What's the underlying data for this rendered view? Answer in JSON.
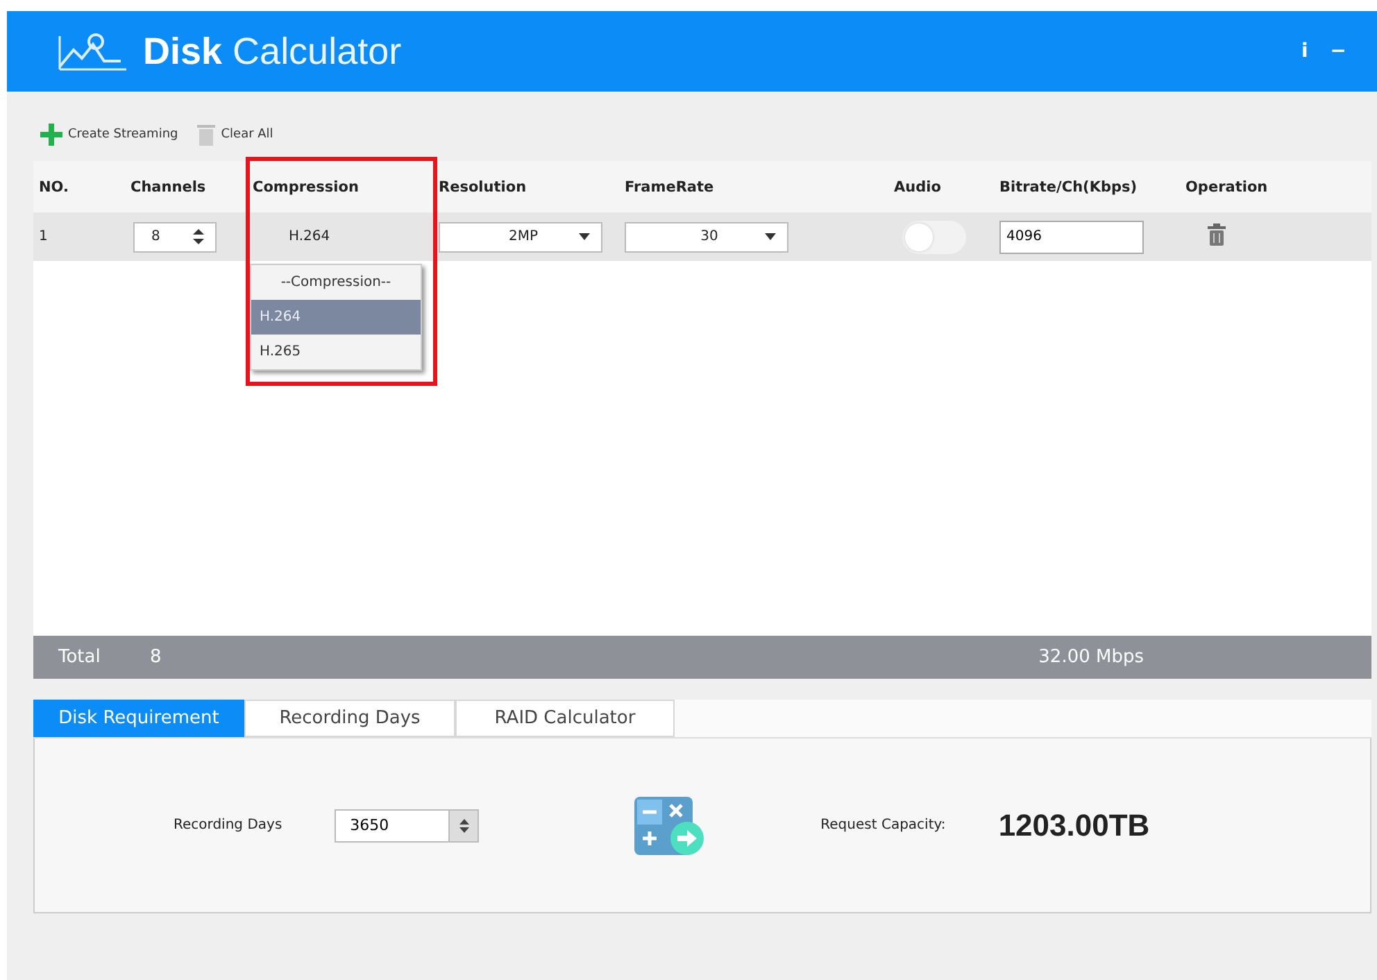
{
  "window": {
    "title_bold": "Disk",
    "title": "Calculator",
    "controls": [
      "i",
      "−"
    ]
  },
  "toolbar": [
    {
      "label": "Create Streaming",
      "kind": "add"
    },
    {
      "label": "Clear All",
      "kind": "clear"
    }
  ],
  "table": {
    "columns": [
      "NO.",
      "Channels",
      "Compression",
      "Resolution",
      "FrameRate",
      "Audio",
      "Bitrate/Ch(Kbps)",
      "Operation"
    ],
    "rows": [
      {
        "no": "1",
        "channels": "8",
        "compression": "H.264",
        "resolution": "2MP",
        "framerate": "30",
        "audio": false,
        "bitrate": "4096"
      }
    ]
  },
  "dropdown": {
    "options": [
      {
        "label": "--Compression--",
        "selected": false
      },
      {
        "label": "H.264",
        "selected": true
      },
      {
        "label": "H.265",
        "selected": false
      }
    ]
  },
  "total": {
    "label": "Total",
    "channels": "8",
    "bitrate": "32.00 Mbps"
  },
  "tabs": [
    {
      "label": "Disk Requirement",
      "selected": true
    },
    {
      "label": "Recording Days",
      "selected": false
    },
    {
      "label": "RAID Calculator",
      "selected": false
    }
  ],
  "panel": {
    "days_label": "Recording Days",
    "days": "3650",
    "capacity_label": "Request Capacity:",
    "capacity": "1203.00TB"
  }
}
